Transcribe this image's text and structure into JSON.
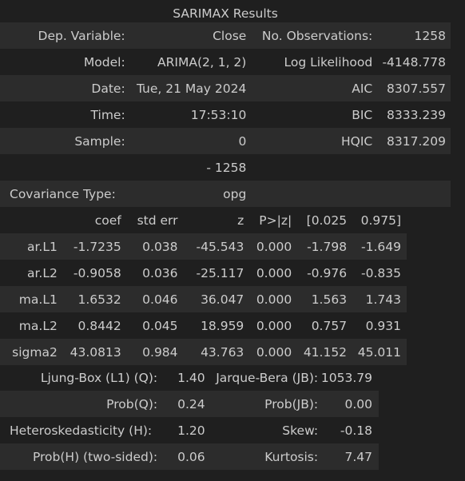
{
  "title": "SARIMAX Results",
  "summary": {
    "dep_variable_label": "Dep. Variable:",
    "dep_variable": "Close",
    "n_obs_label": "No. Observations:",
    "n_obs": "1258",
    "model_label": "Model:",
    "model": "ARIMA(2, 1, 2)",
    "llf_label": "Log Likelihood",
    "llf": "-4148.778",
    "date_label": "Date:",
    "date": "Tue, 21 May 2024",
    "aic_label": "AIC",
    "aic": "8307.557",
    "time_label": "Time:",
    "time": "17:53:10",
    "bic_label": "BIC",
    "bic": "8333.239",
    "sample_label": "Sample:",
    "sample_start": "0",
    "hqic_label": "HQIC",
    "hqic": "8317.209",
    "sample_end": "- 1258",
    "cov_label": "Covariance Type:",
    "cov": "opg"
  },
  "params": {
    "headers": [
      "",
      "coef",
      "std err",
      "z",
      "P>|z|",
      "[0.025",
      "0.975]"
    ],
    "rows": [
      [
        "ar.L1",
        "-1.7235",
        "0.038",
        "-45.543",
        "0.000",
        "-1.798",
        "-1.649"
      ],
      [
        "ar.L2",
        "-0.9058",
        "0.036",
        "-25.117",
        "0.000",
        "-0.976",
        "-0.835"
      ],
      [
        "ma.L1",
        "1.6532",
        "0.046",
        "36.047",
        "0.000",
        "1.563",
        "1.743"
      ],
      [
        "ma.L2",
        "0.8442",
        "0.045",
        "18.959",
        "0.000",
        "0.757",
        "0.931"
      ],
      [
        "sigma2",
        "43.0813",
        "0.984",
        "43.763",
        "0.000",
        "41.152",
        "45.011"
      ]
    ]
  },
  "diagnostics": {
    "rows": [
      [
        "Ljung-Box (L1) (Q):",
        "1.40",
        "Jarque-Bera (JB):",
        "1053.79"
      ],
      [
        "Prob(Q):",
        "0.24",
        "Prob(JB):",
        "0.00"
      ],
      [
        "Heteroskedasticity (H):",
        "1.20",
        "Skew:",
        "-0.18"
      ],
      [
        "Prob(H) (two-sided):",
        "0.06",
        "Kurtosis:",
        "7.47"
      ]
    ]
  }
}
